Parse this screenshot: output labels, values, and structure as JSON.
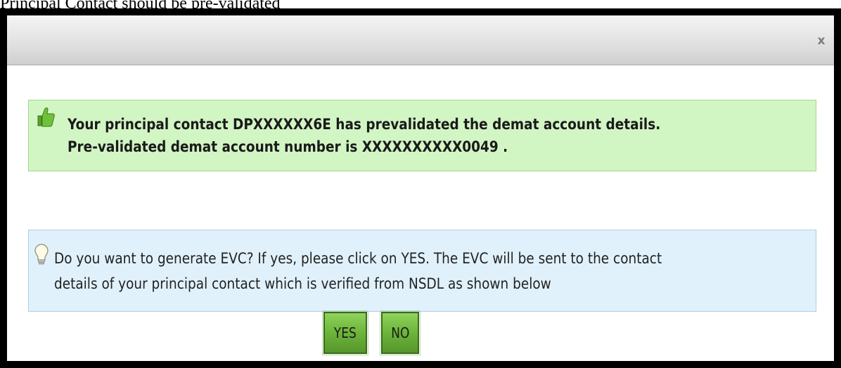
{
  "caption": "Principal Contact should be pre-validated",
  "dialog": {
    "close_glyph": "x",
    "success": {
      "icon": "thumbs-up-icon",
      "line1": "Your principal contact DPXXXXXX6E has prevalidated the demat account details.",
      "line2": "Pre-validated demat account number is XXXXXXXXXX0049 ."
    },
    "info": {
      "icon": "lightbulb-icon",
      "line1": "Do you want to generate EVC? If yes, please click on YES. The EVC will be sent to the contact",
      "line2": "details of your principal contact which is verified from NSDL as shown below"
    },
    "buttons": {
      "yes_label": "YES",
      "no_label": "NO"
    }
  },
  "colors": {
    "success_bg": "#d2f5c4",
    "info_bg": "#e1f1fb",
    "button_green": "#6cb43a"
  }
}
